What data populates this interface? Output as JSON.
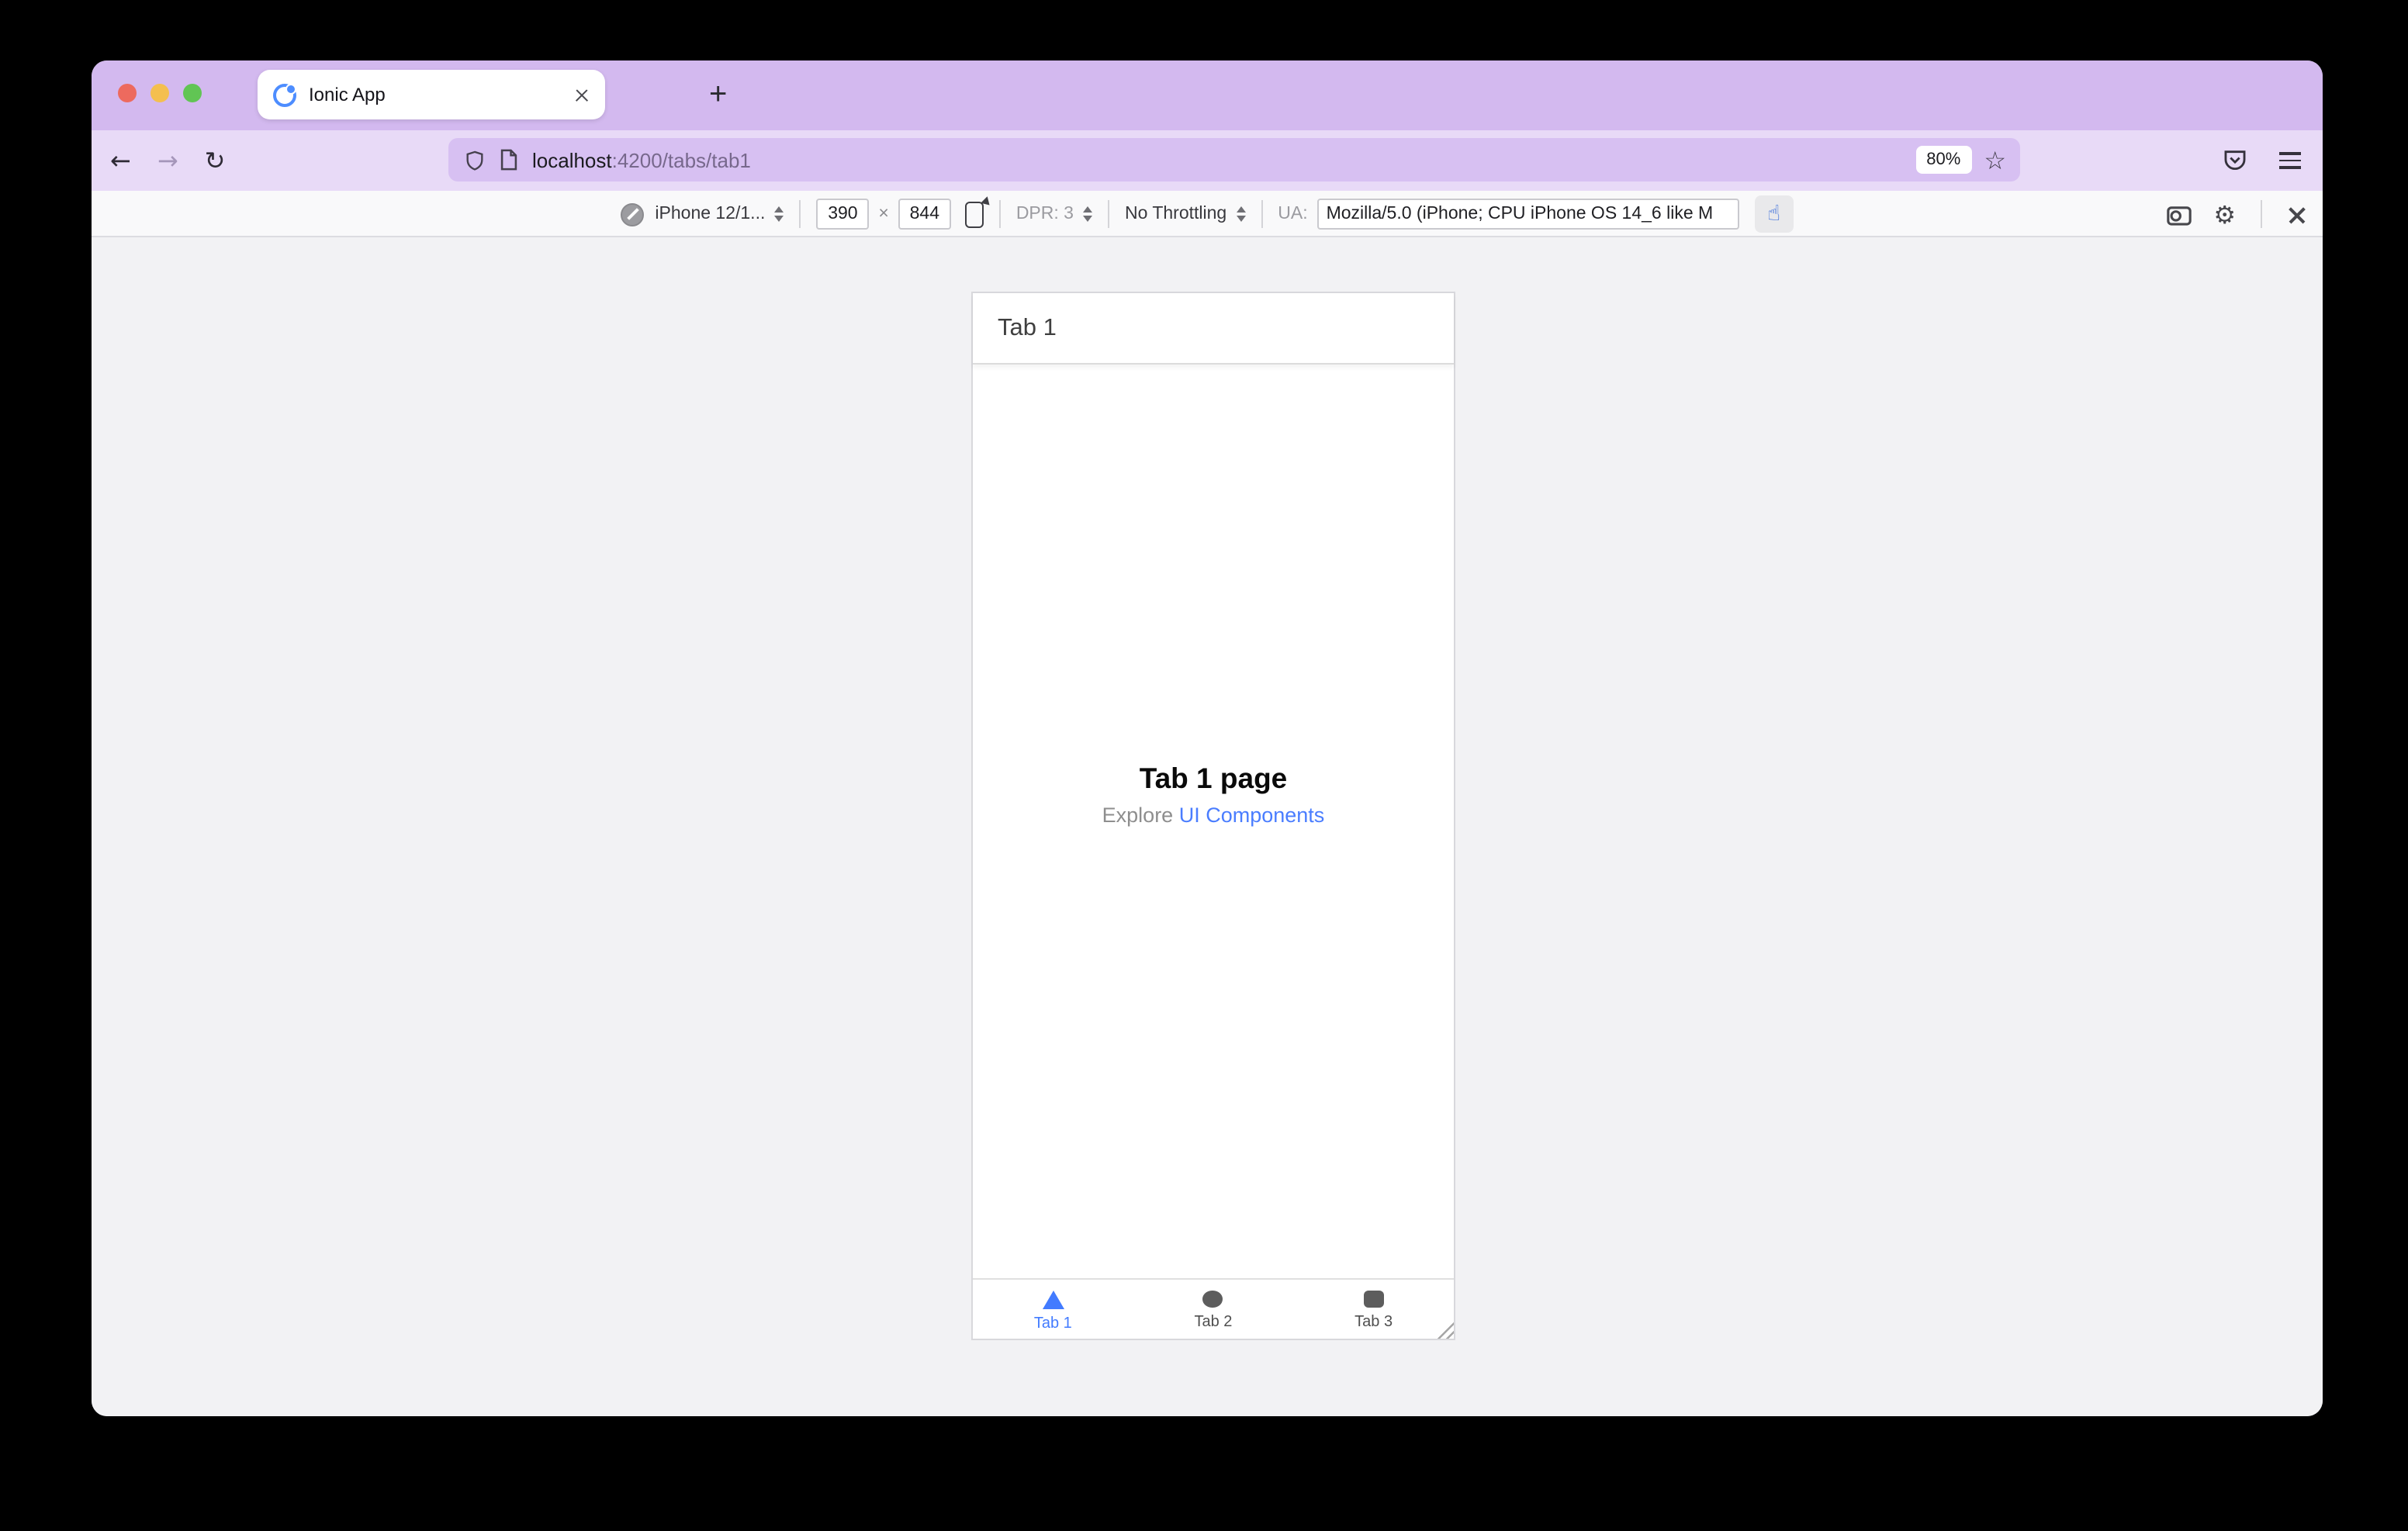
{
  "titlebar": {
    "tab_title": "Ionic App",
    "new_tab_label": "+"
  },
  "urlbar": {
    "host": "localhost",
    "path": ":4200/tabs/tab1",
    "zoom_badge": "80%"
  },
  "rdm": {
    "device": "iPhone 12/1...",
    "width": "390",
    "multiply": "×",
    "height": "844",
    "dpr": "DPR: 3",
    "throttling": "No Throttling",
    "ua_label": "UA:",
    "ua_value": "Mozilla/5.0 (iPhone; CPU iPhone OS 14_6 like M"
  },
  "app": {
    "header_title": "Tab 1",
    "page_title": "Tab 1 page",
    "subtitle_prefix": "Explore ",
    "subtitle_link": "UI Components",
    "tabs": [
      {
        "label": "Tab 1",
        "icon": "triangle-icon",
        "active": true
      },
      {
        "label": "Tab 2",
        "icon": "circle-icon",
        "active": false
      },
      {
        "label": "Tab 3",
        "icon": "square-icon",
        "active": false
      }
    ]
  },
  "colors": {
    "accent_blue": "#3880ff",
    "titlebar_purple": "#d3b9ef",
    "toolbar_purple": "#e8daf7",
    "urlfield_purple": "#d7c0f2",
    "traffic_red": "#ed6a5e",
    "traffic_yellow": "#f4bf4f",
    "traffic_green": "#61c554"
  }
}
